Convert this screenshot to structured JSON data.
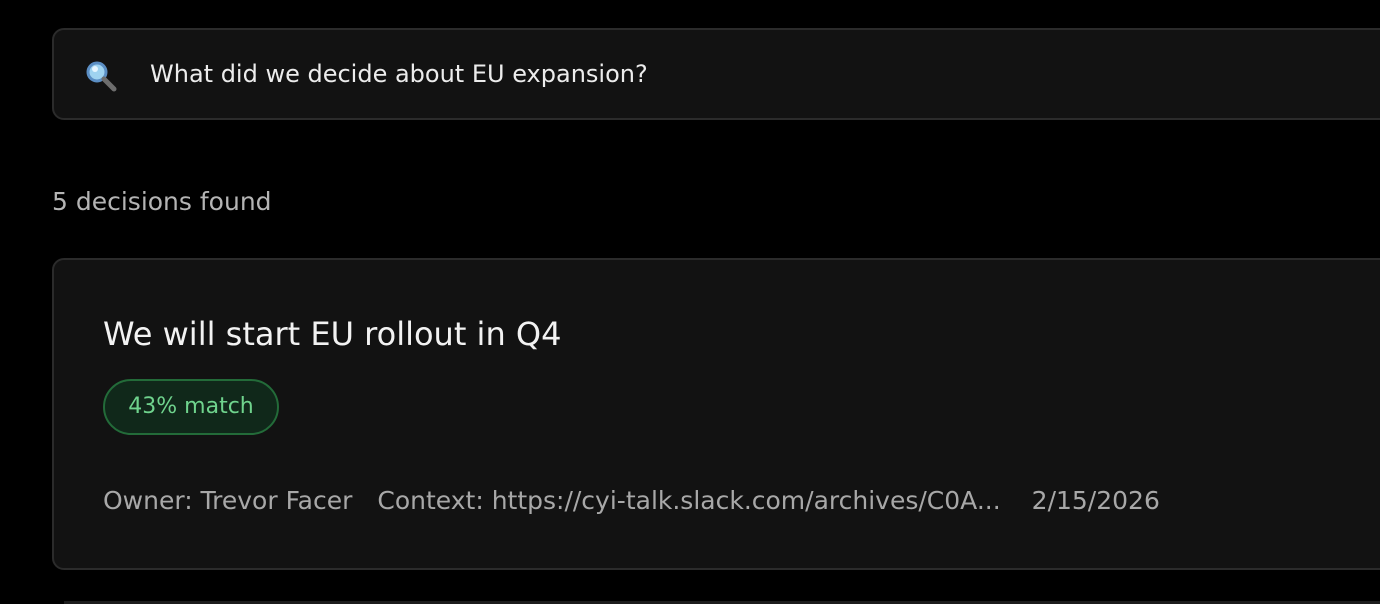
{
  "search": {
    "icon": "search-icon",
    "query": "What did we decide about EU expansion?"
  },
  "results": {
    "count_text": "5 decisions found",
    "items": [
      {
        "title": "We will start EU rollout in Q4",
        "match": "43% match",
        "owner": "Owner: Trevor Facer",
        "context": "Context: https://cyi-talk.slack.com/archives/C0A...",
        "date": "2/15/2026"
      }
    ]
  },
  "colors": {
    "background": "#000000",
    "panel": "#121212",
    "border": "#2b2b2b",
    "match_text": "#6fd38d",
    "match_border": "#236b39"
  }
}
